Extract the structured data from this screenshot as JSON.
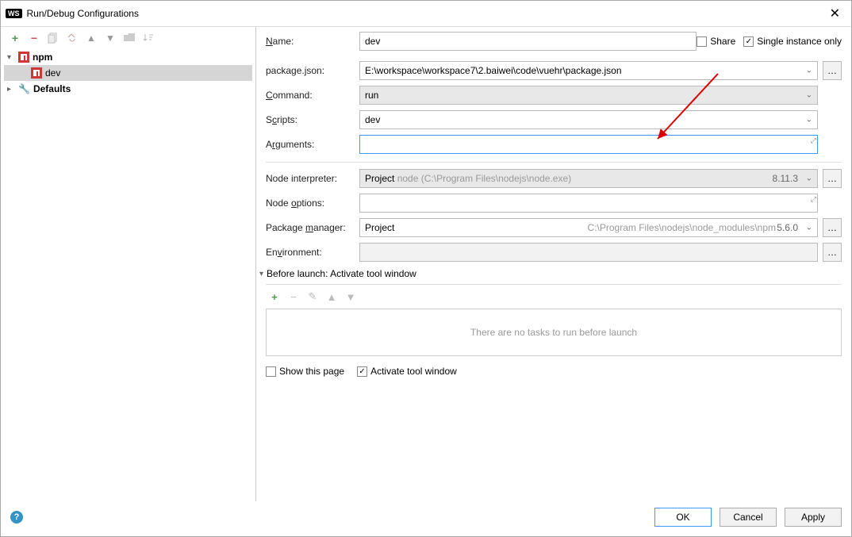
{
  "window": {
    "title": "Run/Debug Configurations"
  },
  "tree": {
    "npm": "npm",
    "dev": "dev",
    "defaults": "Defaults"
  },
  "form": {
    "name_label": "Name:",
    "name_value": "dev",
    "share_label": "Share",
    "single_instance_label": "Single instance only",
    "package_json_label": "package.json:",
    "package_json_value": "E:\\workspace\\workspace7\\2.baiwei\\code\\vuehr\\package.json",
    "command_label": "Command:",
    "command_value": "run",
    "scripts_label": "Scripts:",
    "scripts_value": "dev",
    "arguments_label": "Arguments:",
    "arguments_value": "",
    "node_interpreter_label": "Node interpreter:",
    "node_interpreter_prefix": "Project",
    "node_interpreter_path": "node (C:\\Program Files\\nodejs\\node.exe)",
    "node_interpreter_version": "8.11.3",
    "node_options_label": "Node options:",
    "package_manager_label": "Package manager:",
    "package_manager_prefix": "Project",
    "package_manager_path": "C:\\Program Files\\nodejs\\node_modules\\npm",
    "package_manager_version": "5.6.0",
    "environment_label": "Environment:"
  },
  "before": {
    "section_title": "Before launch: Activate tool window",
    "empty_text": "There are no tasks to run before launch",
    "show_this_page": "Show this page",
    "activate_tool_window": "Activate tool window"
  },
  "buttons": {
    "ok": "OK",
    "cancel": "Cancel",
    "apply": "Apply"
  }
}
